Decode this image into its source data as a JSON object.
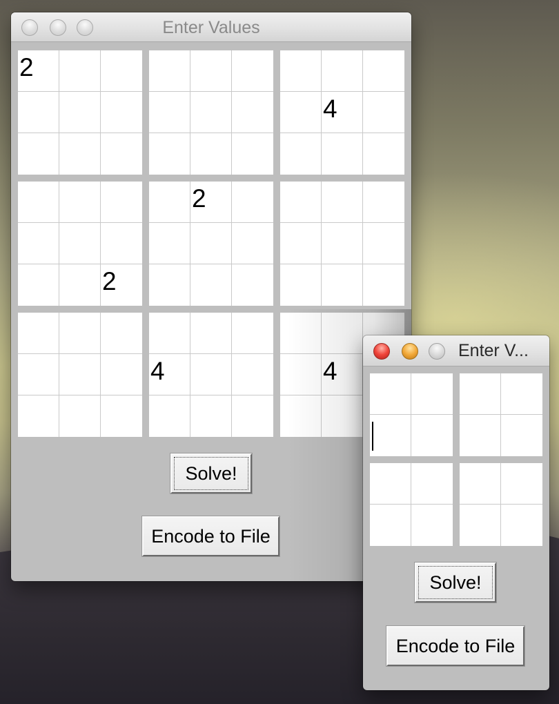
{
  "main_window": {
    "title": "Enter Values",
    "grid": [
      [
        "2",
        "",
        "",
        "",
        "",
        "",
        "",
        "",
        ""
      ],
      [
        "",
        "",
        "",
        "",
        "",
        "",
        "",
        "4",
        ""
      ],
      [
        "",
        "",
        "",
        "",
        "",
        "",
        "",
        "",
        ""
      ],
      [
        "",
        "",
        "",
        "",
        "2",
        "",
        "",
        "",
        ""
      ],
      [
        "",
        "",
        "",
        "",
        "",
        "",
        "",
        "",
        ""
      ],
      [
        "",
        "",
        "2",
        "",
        "",
        "",
        "",
        "",
        ""
      ],
      [
        "",
        "",
        "",
        "",
        "",
        "",
        "",
        "",
        ""
      ],
      [
        "",
        "",
        "",
        "4",
        "",
        "",
        "",
        "4",
        ""
      ],
      [
        "",
        "",
        "",
        "",
        "",
        "",
        "",
        "",
        ""
      ]
    ],
    "solve_label": "Solve!",
    "encode_label": "Encode to File"
  },
  "small_window": {
    "title": "Enter V...",
    "grid": [
      [
        "",
        "",
        "",
        ""
      ],
      [
        "",
        "",
        "",
        ""
      ],
      [
        "",
        "",
        "",
        ""
      ],
      [
        "",
        "",
        "",
        ""
      ]
    ],
    "solve_label": "Solve!",
    "encode_label": "Encode to File"
  },
  "colors": {
    "window_body": "#bebebe",
    "cell_border": "#c9c9c9",
    "close_active": "#f0453b",
    "minimize_active": "#f2a93a"
  }
}
